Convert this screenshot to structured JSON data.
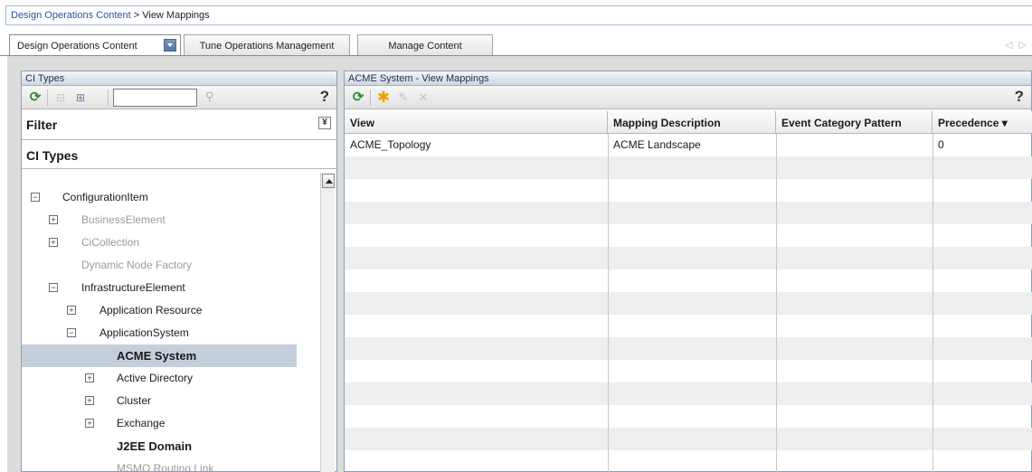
{
  "breadcrumb": {
    "link": "Design Operations Content",
    "separator": " > ",
    "current": "View Mappings"
  },
  "tabs": [
    {
      "label": "Design Operations Content",
      "active": true
    },
    {
      "label": "Tune Operations Management",
      "active": false
    },
    {
      "label": "Manage Content",
      "active": false
    }
  ],
  "left_panel": {
    "title": "CI Types",
    "search": {
      "value": "",
      "placeholder": ""
    },
    "help": "?",
    "filter_label": "Filter",
    "section_label": "CI Types",
    "tree": [
      {
        "label": "ConfigurationItem",
        "expander": "−",
        "style": "normal"
      },
      {
        "label": "BusinessElement",
        "expander": "+",
        "style": "grey"
      },
      {
        "label": "CiCollection",
        "expander": "+",
        "style": "grey"
      },
      {
        "label": "Dynamic Node Factory",
        "expander": "",
        "style": "grey"
      },
      {
        "label": "InfrastructureElement",
        "expander": "−",
        "style": "normal"
      },
      {
        "label": "Application Resource",
        "expander": "+",
        "style": "med"
      },
      {
        "label": "ApplicationSystem",
        "expander": "−",
        "style": "normal"
      },
      {
        "label": "ACME System",
        "expander": "",
        "style": "bold",
        "selected": true
      },
      {
        "label": "Active Directory",
        "expander": "+",
        "style": "med"
      },
      {
        "label": "Cluster",
        "expander": "+",
        "style": "med"
      },
      {
        "label": "Exchange",
        "expander": "+",
        "style": "med"
      },
      {
        "label": "J2EE Domain",
        "expander": "",
        "style": "bold"
      },
      {
        "label": "MSMQ Routing Link",
        "expander": "",
        "style": "grey"
      }
    ]
  },
  "right_panel": {
    "title": "ACME System - View Mappings",
    "help": "?",
    "columns": [
      "View",
      "Mapping Description",
      "Event Category Pattern",
      "Precedence ▾"
    ],
    "rows": [
      [
        "ACME_Topology",
        "ACME Landscape",
        "",
        "0"
      ]
    ]
  },
  "nav_arrows": "◁ ▷"
}
